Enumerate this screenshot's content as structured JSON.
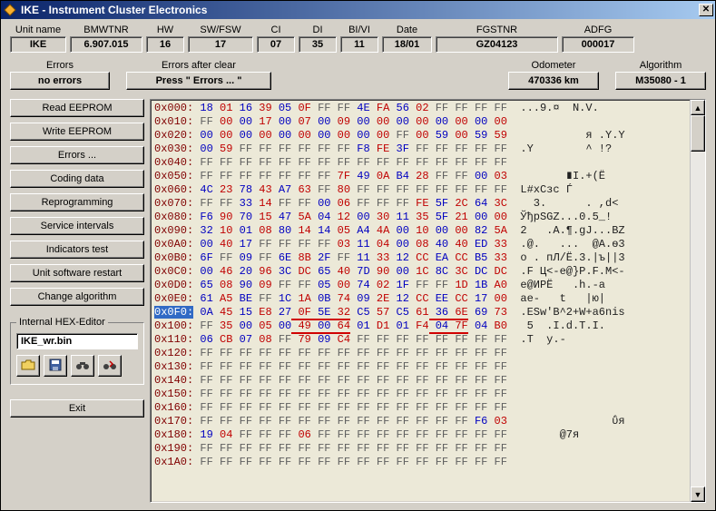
{
  "window": {
    "title": "IKE - Instrument Cluster Electronics",
    "close_glyph": "✕"
  },
  "info": {
    "labels": {
      "unit_name": "Unit name",
      "bmwtnr": "BMWTNR",
      "hw": "HW",
      "swfsw": "SW/FSW",
      "ci": "CI",
      "di": "DI",
      "bivi": "BI/VI",
      "date": "Date",
      "fgstnr": "FGSTNR",
      "adfg": "ADFG"
    },
    "values": {
      "unit_name": "IKE",
      "bmwtnr": "6.907.015",
      "hw": "16",
      "swfsw": "17",
      "ci": "07",
      "di": "35",
      "bivi": "11",
      "date": "18/01",
      "fgstnr": "GZ04123",
      "adfg": "000017"
    }
  },
  "errors": {
    "errors_label": "Errors",
    "errors_value": "no errors",
    "after_label": "Errors after clear",
    "after_value": "Press \" Errors ... \"",
    "odometer_label": "Odometer",
    "odometer_value": "470336 km",
    "algorithm_label": "Algorithm",
    "algorithm_value": "M35080 - 1"
  },
  "sidebar": {
    "buttons": [
      "Read EEPROM",
      "Write EEPROM",
      "Errors ...",
      "Coding data",
      "Reprogramming",
      "Service intervals",
      "Indicators test",
      "Unit software restart",
      "Change algorithm"
    ],
    "hex_editor_legend": "Internal HEX-Editor",
    "filename": "IKE_wr.bin",
    "exit": "Exit"
  },
  "hex": {
    "highlight_addr": "0x0F0",
    "rows": [
      {
        "addr": "0x000",
        "b": [
          "18",
          "01",
          "16",
          "39",
          "05",
          "0F",
          "FF",
          "FF",
          "4E",
          "FA",
          "56",
          "02",
          "FF",
          "FF",
          "FF",
          "FF"
        ],
        "asc": "...9.¤  N.V.    "
      },
      {
        "addr": "0x010",
        "b": [
          "FF",
          "00",
          "00",
          "17",
          "00",
          "07",
          "00",
          "09",
          "00",
          "00",
          "00",
          "00",
          "00",
          "00",
          "00",
          "00"
        ],
        "asc": "                "
      },
      {
        "addr": "0x020",
        "b": [
          "00",
          "00",
          "00",
          "00",
          "00",
          "00",
          "00",
          "00",
          "00",
          "00",
          "FF",
          "00",
          "59",
          "00",
          "59",
          "59"
        ],
        "asc": "          я .Y.Y"
      },
      {
        "addr": "0x030",
        "b": [
          "00",
          "59",
          "FF",
          "FF",
          "FF",
          "FF",
          "FF",
          "FF",
          "F8",
          "FE",
          "3F",
          "FF",
          "FF",
          "FF",
          "FF",
          "FF"
        ],
        "asc": ".Y        ^ !?  "
      },
      {
        "addr": "0x040",
        "b": [
          "FF",
          "FF",
          "FF",
          "FF",
          "FF",
          "FF",
          "FF",
          "FF",
          "FF",
          "FF",
          "FF",
          "FF",
          "FF",
          "FF",
          "FF",
          "FF"
        ],
        "asc": "                "
      },
      {
        "addr": "0x050",
        "b": [
          "FF",
          "FF",
          "FF",
          "FF",
          "FF",
          "FF",
          "FF",
          "7F",
          "49",
          "0A",
          "B4",
          "28",
          "FF",
          "FF",
          "00",
          "03"
        ],
        "asc": "       ∎I.+(Ё   "
      },
      {
        "addr": "0x060",
        "b": [
          "4C",
          "23",
          "78",
          "43",
          "A7",
          "63",
          "FF",
          "80",
          "FF",
          "FF",
          "FF",
          "FF",
          "FF",
          "FF",
          "FF",
          "FF"
        ],
        "asc": "L#xCзc Ѓ        "
      },
      {
        "addr": "0x070",
        "b": [
          "FF",
          "FF",
          "33",
          "14",
          "FF",
          "FF",
          "00",
          "06",
          "FF",
          "FF",
          "FF",
          "FE",
          "5F",
          "2C",
          "64",
          "3C"
        ],
        "asc": "  3.      . ,d<"
      },
      {
        "addr": "0x080",
        "b": [
          "F6",
          "90",
          "70",
          "15",
          "47",
          "5A",
          "04",
          "12",
          "00",
          "30",
          "11",
          "35",
          "5F",
          "21",
          "00",
          "00"
        ],
        "asc": "ЎђpSGZ...0.5_!  "
      },
      {
        "addr": "0x090",
        "b": [
          "32",
          "10",
          "01",
          "08",
          "80",
          "14",
          "14",
          "05",
          "A4",
          "4A",
          "00",
          "10",
          "00",
          "00",
          "82",
          "5A"
        ],
        "asc": "2   .A.¶.gJ...BZ"
      },
      {
        "addr": "0x0A0",
        "b": [
          "00",
          "40",
          "17",
          "FF",
          "FF",
          "FF",
          "FF",
          "03",
          "11",
          "04",
          "00",
          "08",
          "40",
          "40",
          "ED",
          "33"
        ],
        "asc": ".@.   ...  @A.ѳ3"
      },
      {
        "addr": "0x0B0",
        "b": [
          "6F",
          "FF",
          "09",
          "FF",
          "6E",
          "8B",
          "2F",
          "FF",
          "11",
          "33",
          "12",
          "CC",
          "EA",
          "CC",
          "B5",
          "33"
        ],
        "asc": "o . пЛ/Ё.3.|ъ||3"
      },
      {
        "addr": "0x0C0",
        "b": [
          "00",
          "46",
          "20",
          "96",
          "3C",
          "DC",
          "65",
          "40",
          "7D",
          "90",
          "00",
          "1C",
          "8C",
          "3C",
          "DC",
          "DC"
        ],
        "asc": ".F Ц<-е@}P.F.M<-"
      },
      {
        "addr": "0x0D0",
        "b": [
          "65",
          "08",
          "90",
          "09",
          "FF",
          "FF",
          "05",
          "00",
          "74",
          "02",
          "1F",
          "FF",
          "FF",
          "1D",
          "1B",
          "A0"
        ],
        "asc": "e@ИPЁ   .h.-a   "
      },
      {
        "addr": "0x0E0",
        "b": [
          "61",
          "A5",
          "BE",
          "FF",
          "1C",
          "1A",
          "0B",
          "74",
          "09",
          "2E",
          "12",
          "CC",
          "EE",
          "CC",
          "17",
          "00"
        ],
        "asc": "aе-   t   |ю|   "
      },
      {
        "addr": "0x0F0",
        "b": [
          "0A",
          "45",
          "15",
          "E8",
          "27",
          "0F",
          "5E",
          "32",
          "C5",
          "57",
          "C5",
          "61",
          "36",
          "6E",
          "69",
          "73"
        ],
        "asc": ".ESw'В^2+W+a6nis"
      },
      {
        "addr": "0x100",
        "b": [
          "FF",
          "35",
          "00",
          "05",
          "00",
          "49",
          "00",
          "64",
          "01",
          "D1",
          "01",
          "F4",
          "04",
          "7F",
          "04",
          "B0"
        ],
        "asc": " 5  .I.d.T.I.   "
      },
      {
        "addr": "0x110",
        "b": [
          "06",
          "CB",
          "07",
          "08",
          "FF",
          "79",
          "09",
          "C4",
          "FF",
          "FF",
          "FF",
          "FF",
          "FF",
          "FF",
          "FF",
          "FF"
        ],
        "asc": ".T  y.-          "
      },
      {
        "addr": "0x120",
        "b": [
          "FF",
          "FF",
          "FF",
          "FF",
          "FF",
          "FF",
          "FF",
          "FF",
          "FF",
          "FF",
          "FF",
          "FF",
          "FF",
          "FF",
          "FF",
          "FF"
        ],
        "asc": "                "
      },
      {
        "addr": "0x130",
        "b": [
          "FF",
          "FF",
          "FF",
          "FF",
          "FF",
          "FF",
          "FF",
          "FF",
          "FF",
          "FF",
          "FF",
          "FF",
          "FF",
          "FF",
          "FF",
          "FF"
        ],
        "asc": "                "
      },
      {
        "addr": "0x140",
        "b": [
          "FF",
          "FF",
          "FF",
          "FF",
          "FF",
          "FF",
          "FF",
          "FF",
          "FF",
          "FF",
          "FF",
          "FF",
          "FF",
          "FF",
          "FF",
          "FF"
        ],
        "asc": "                "
      },
      {
        "addr": "0x150",
        "b": [
          "FF",
          "FF",
          "FF",
          "FF",
          "FF",
          "FF",
          "FF",
          "FF",
          "FF",
          "FF",
          "FF",
          "FF",
          "FF",
          "FF",
          "FF",
          "FF"
        ],
        "asc": "                "
      },
      {
        "addr": "0x160",
        "b": [
          "FF",
          "FF",
          "FF",
          "FF",
          "FF",
          "FF",
          "FF",
          "FF",
          "FF",
          "FF",
          "FF",
          "FF",
          "FF",
          "FF",
          "FF",
          "FF"
        ],
        "asc": "                "
      },
      {
        "addr": "0x170",
        "b": [
          "FF",
          "FF",
          "FF",
          "FF",
          "FF",
          "FF",
          "FF",
          "FF",
          "FF",
          "FF",
          "FF",
          "FF",
          "FF",
          "FF",
          "F6",
          "03"
        ],
        "asc": "              ΰя"
      },
      {
        "addr": "0x180",
        "b": [
          "19",
          "04",
          "FF",
          "FF",
          "FF",
          "06",
          "FF",
          "FF",
          "FF",
          "FF",
          "FF",
          "FF",
          "FF",
          "FF",
          "FF",
          "FF"
        ],
        "asc": "      @7я       "
      },
      {
        "addr": "0x190",
        "b": [
          "FF",
          "FF",
          "FF",
          "FF",
          "FF",
          "FF",
          "FF",
          "FF",
          "FF",
          "FF",
          "FF",
          "FF",
          "FF",
          "FF",
          "FF",
          "FF"
        ],
        "asc": "                "
      },
      {
        "addr": "0x1A0",
        "b": [
          "FF",
          "FF",
          "FF",
          "FF",
          "FF",
          "FF",
          "FF",
          "FF",
          "FF",
          "FF",
          "FF",
          "FF",
          "FF",
          "FF",
          "FF",
          "FF"
        ],
        "asc": "                "
      }
    ]
  }
}
